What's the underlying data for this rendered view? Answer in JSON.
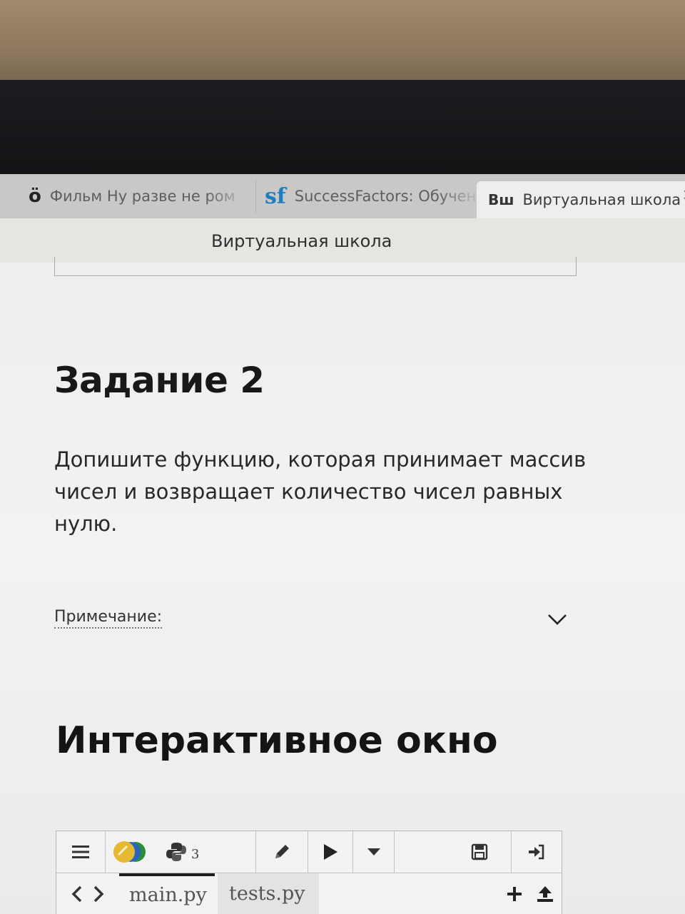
{
  "browser": {
    "tabs": [
      {
        "icon": "ö",
        "label": "Фильм Ну разве не ром"
      },
      {
        "icon": "sf",
        "label": "SuccessFactors: Обучен"
      },
      {
        "icon": "Вш",
        "label": "Виртуальная школа"
      }
    ],
    "window_title": "Виртуальная школа"
  },
  "task": {
    "heading": "Задание 2",
    "description": "Допишите функцию, которая принимает массив чисел и возвращает количество чисел равных нулю.",
    "note_label": "Примечание:"
  },
  "interactive": {
    "heading": "Интерактивное окно",
    "python_version": "3",
    "files": [
      "main.py",
      "tests.py"
    ]
  },
  "colors": {
    "sf_icon": "#1a7fc1",
    "text_dark": "#181818"
  }
}
